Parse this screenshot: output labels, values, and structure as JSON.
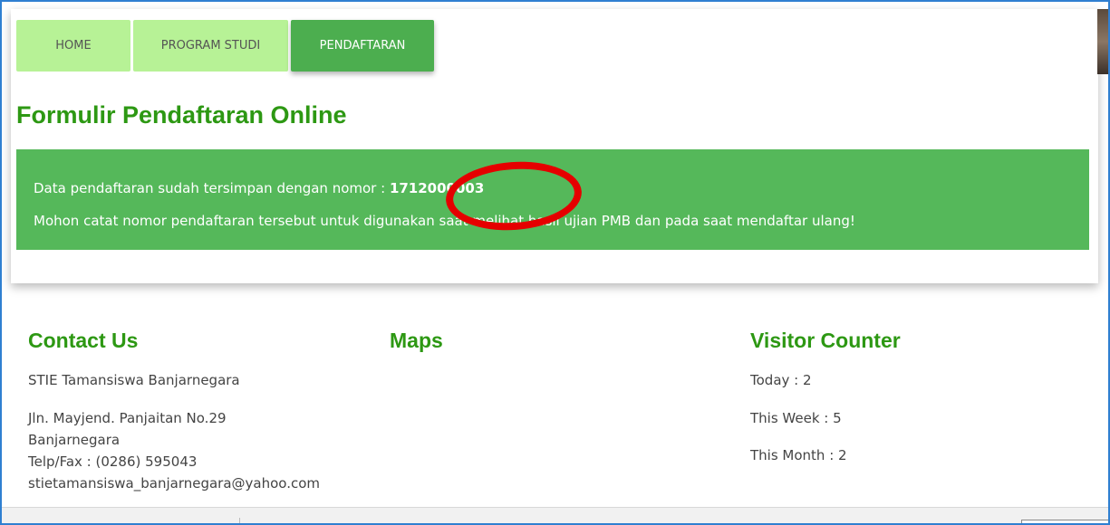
{
  "nav": {
    "items": [
      {
        "label": "HOME"
      },
      {
        "label": "PROGRAM STUDI"
      },
      {
        "label": "PENDAFTARAN",
        "active": true
      }
    ]
  },
  "form": {
    "title": "Formulir Pendaftaran Online"
  },
  "alert": {
    "line1_prefix": "Data pendaftaran sudah tersimpan dengan nomor : ",
    "registration_number": "1712000003",
    "line2": "Mohon catat nomor pendaftaran tersebut untuk digunakan saat melihat hasil ujian PMB dan pada saat mendaftar ulang!",
    "background_color": "#55b85a",
    "highlight_color": "#e50000"
  },
  "footer": {
    "contact": {
      "heading": "Contact Us",
      "name": "STIE Tamansiswa Banjarnegara",
      "address_line1": "Jln. Mayjend. Panjaitan No.29",
      "address_line2": "Banjarnegara",
      "phone": "Telp/Fax : (0286) 595043",
      "email": "stietamansiswa_banjarnegara@yahoo.com"
    },
    "maps": {
      "heading": "Maps"
    },
    "visitor": {
      "heading": "Visitor Counter",
      "today": "Today : 2",
      "this_week": "This Week : 5",
      "this_month": "This Month : 2"
    }
  },
  "colors": {
    "accent_green": "#2d9813",
    "nav_inactive": "#b7f296",
    "nav_active": "#4cae4f",
    "frame_border": "#2f7fd1"
  }
}
